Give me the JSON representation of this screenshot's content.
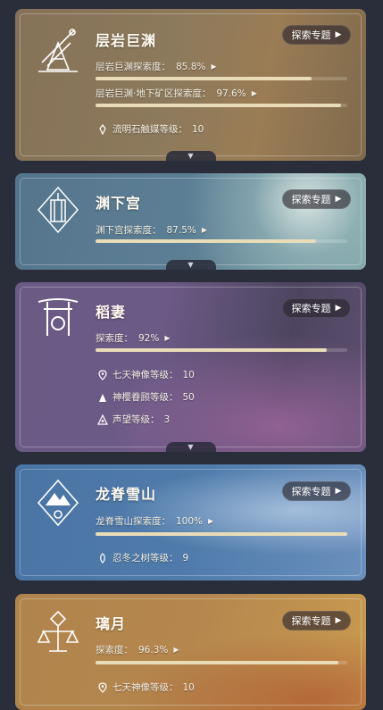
{
  "topic_button_label": "探索专题",
  "regions": [
    {
      "name": "层岩巨渊",
      "emblem": "mining-rig-emblem-icon",
      "stats": [
        {
          "label": "层岩巨渊探索度：",
          "value": "85.8%",
          "progress": 0.858
        },
        {
          "label": "层岩巨渊·地下矿区探索度：",
          "value": "97.6%",
          "progress": 0.976
        }
      ],
      "levels": [
        {
          "icon": "lumenstone-icon",
          "label": "流明石触媒等级：",
          "value": "10"
        }
      ]
    },
    {
      "name": "渊下宫",
      "emblem": "enkanomiya-emblem-icon",
      "stats": [
        {
          "label": "渊下宫探索度：",
          "value": "87.5%",
          "progress": 0.875
        }
      ],
      "levels": []
    },
    {
      "name": "稻妻",
      "emblem": "torii-emblem-icon",
      "stats": [
        {
          "label": "探索度：",
          "value": "92%",
          "progress": 0.92
        }
      ],
      "levels": [
        {
          "icon": "location-pin-icon",
          "label": "七天神像等级：",
          "value": "10"
        },
        {
          "icon": "sakura-tree-icon",
          "label": "神樱眷顾等级：",
          "value": "50"
        },
        {
          "icon": "reputation-icon",
          "label": "声望等级：",
          "value": "3"
        }
      ]
    },
    {
      "name": "龙脊雪山",
      "emblem": "snow-mountain-emblem-icon",
      "stats": [
        {
          "label": "龙脊雪山探索度：",
          "value": "100%",
          "progress": 1.0
        }
      ],
      "levels": [
        {
          "icon": "frostbearing-tree-icon",
          "label": "忍冬之树等级：",
          "value": "9"
        }
      ]
    },
    {
      "name": "璃月",
      "emblem": "liyue-emblem-icon",
      "stats": [
        {
          "label": "探索度：",
          "value": "96.3%",
          "progress": 0.963
        }
      ],
      "levels": [
        {
          "icon": "location-pin-icon",
          "label": "七天神像等级：",
          "value": "10"
        }
      ]
    }
  ],
  "colors": {
    "chasm": "#8a7356",
    "enkanomiya": "#5d7f95",
    "inazuma": "#6c5a86",
    "dragonspine": "#4f7bab",
    "liyue": "#b5874e",
    "bar_fill": "#e9dcb8"
  }
}
